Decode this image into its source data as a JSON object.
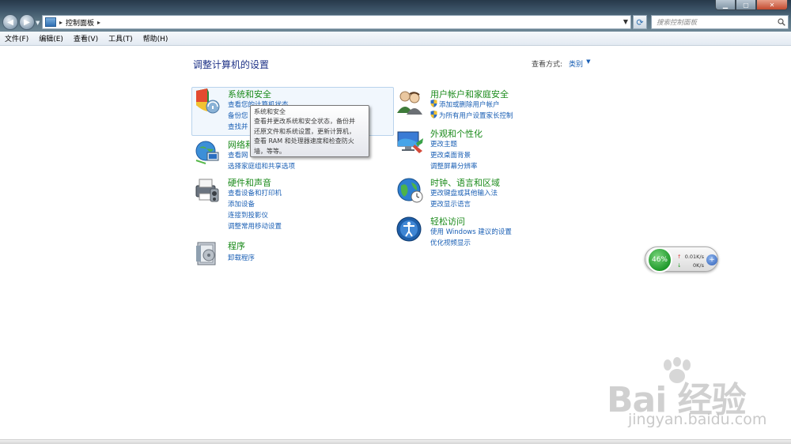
{
  "address": {
    "path": "控制面板"
  },
  "search": {
    "placeholder": "搜索控制面板"
  },
  "menu": [
    "文件(F)",
    "编辑(E)",
    "查看(V)",
    "工具(T)",
    "帮助(H)"
  ],
  "page": {
    "title": "调整计算机的设置",
    "view_by_label": "查看方式:",
    "view_by_value": "类别"
  },
  "categories": {
    "system": {
      "title": "系统和安全",
      "links": [
        "查看您的计算机状态",
        "备份您",
        "查找并"
      ]
    },
    "network": {
      "title": "网络和",
      "links": [
        "查看网",
        "选择家庭组和共享选项"
      ]
    },
    "hardware": {
      "title": "硬件和声音",
      "links": [
        "查看设备和打印机",
        "添加设备",
        "连接到投影仪",
        "调整常用移动设置"
      ]
    },
    "programs": {
      "title": "程序",
      "links": [
        "卸载程序"
      ]
    },
    "users": {
      "title": "用户帐户和家庭安全",
      "links": [
        "添加或删除用户帐户",
        "为所有用户设置家长控制"
      ]
    },
    "appearance": {
      "title": "外观和个性化",
      "links": [
        "更改主题",
        "更改桌面背景",
        "调整屏幕分辨率"
      ]
    },
    "clock": {
      "title": "时钟、语言和区域",
      "links": [
        "更改键盘或其他输入法",
        "更改显示语言"
      ]
    },
    "ease": {
      "title": "轻松访问",
      "links": [
        "使用 Windows 建议的设置",
        "优化视频显示"
      ]
    }
  },
  "tooltip": {
    "lines": [
      "系统和安全",
      "查看并更改系统和安全状态，备份并",
      "还原文件和系统设置，更新计算机，",
      "查看 RAM 和处理器速度和检查防火",
      "墙，等等。"
    ]
  },
  "net_widget": {
    "percent": "46%",
    "upload": "0.01K/s",
    "download": "0K/s"
  },
  "watermark": {
    "brand": "Bai 经验",
    "url": "jingyan.baidu.com"
  }
}
